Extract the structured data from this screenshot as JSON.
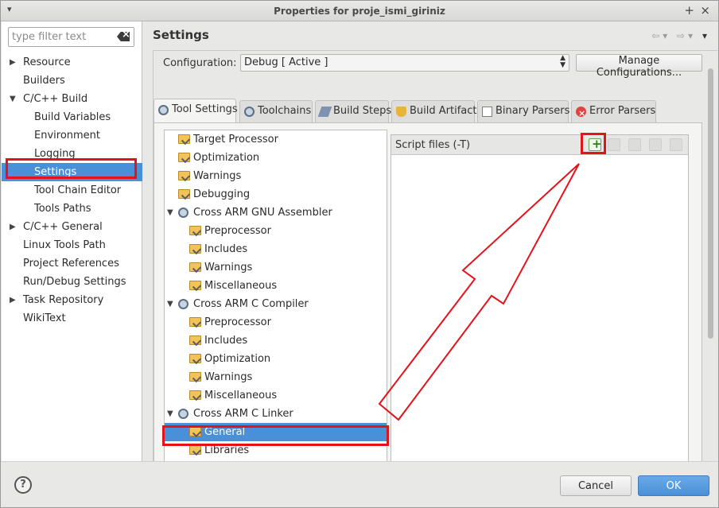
{
  "window": {
    "title": "Properties for proje_ismi_giriniz"
  },
  "filter": {
    "placeholder": "type filter text"
  },
  "nav": {
    "items": [
      {
        "label": "Resource",
        "expander": "▶"
      },
      {
        "label": "Builders",
        "expander": ""
      },
      {
        "label": "C/C++ Build",
        "expander": "▼"
      },
      {
        "label": "Build Variables",
        "expander": ""
      },
      {
        "label": "Environment",
        "expander": ""
      },
      {
        "label": "Logging",
        "expander": ""
      },
      {
        "label": "Settings",
        "expander": ""
      },
      {
        "label": "Tool Chain Editor",
        "expander": ""
      },
      {
        "label": "Tools Paths",
        "expander": ""
      },
      {
        "label": "C/C++ General",
        "expander": "▶"
      },
      {
        "label": "Linux Tools Path",
        "expander": ""
      },
      {
        "label": "Project References",
        "expander": ""
      },
      {
        "label": "Run/Debug Settings",
        "expander": ""
      },
      {
        "label": "Task Repository",
        "expander": "▶"
      },
      {
        "label": "WikiText",
        "expander": ""
      }
    ]
  },
  "page": {
    "title": "Settings",
    "nav_back": "⇦",
    "nav_forward": "⇨",
    "nav_menu": "▾"
  },
  "config": {
    "label": "Configuration:",
    "value": "Debug  [ Active ]",
    "manage_label": "Manage Configurations..."
  },
  "tabs": [
    {
      "label": "Tool Settings",
      "icon": "gear-icon"
    },
    {
      "label": "Toolchains",
      "icon": "gear-icon"
    },
    {
      "label": "Build Steps",
      "icon": "build-steps-icon"
    },
    {
      "label": "Build Artifact",
      "icon": "trophy-icon"
    },
    {
      "label": "Binary Parsers",
      "icon": "binary-icon"
    },
    {
      "label": "Error Parsers",
      "icon": "error-icon"
    }
  ],
  "tool_tree": [
    {
      "label": "Target Processor",
      "type": "option"
    },
    {
      "label": "Optimization",
      "type": "option"
    },
    {
      "label": "Warnings",
      "type": "option"
    },
    {
      "label": "Debugging",
      "type": "option"
    },
    {
      "label": "Cross ARM GNU Assembler",
      "type": "tool",
      "expander": "▼"
    },
    {
      "label": "Preprocessor",
      "type": "child"
    },
    {
      "label": "Includes",
      "type": "child"
    },
    {
      "label": "Warnings",
      "type": "child"
    },
    {
      "label": "Miscellaneous",
      "type": "child"
    },
    {
      "label": "Cross ARM C Compiler",
      "type": "tool",
      "expander": "▼"
    },
    {
      "label": "Preprocessor",
      "type": "child"
    },
    {
      "label": "Includes",
      "type": "child"
    },
    {
      "label": "Optimization",
      "type": "child"
    },
    {
      "label": "Warnings",
      "type": "child"
    },
    {
      "label": "Miscellaneous",
      "type": "child"
    },
    {
      "label": "Cross ARM C Linker",
      "type": "tool",
      "expander": "▼"
    },
    {
      "label": "General",
      "type": "child"
    },
    {
      "label": "Libraries",
      "type": "child"
    }
  ],
  "script_panel": {
    "title": "Script files (-T)"
  },
  "buttons": {
    "help": "?",
    "cancel": "Cancel",
    "ok": "OK"
  },
  "colors": {
    "selection": "#4a90d9",
    "highlight_box": "#e3131b",
    "ok_button": "#4a8fd6"
  }
}
